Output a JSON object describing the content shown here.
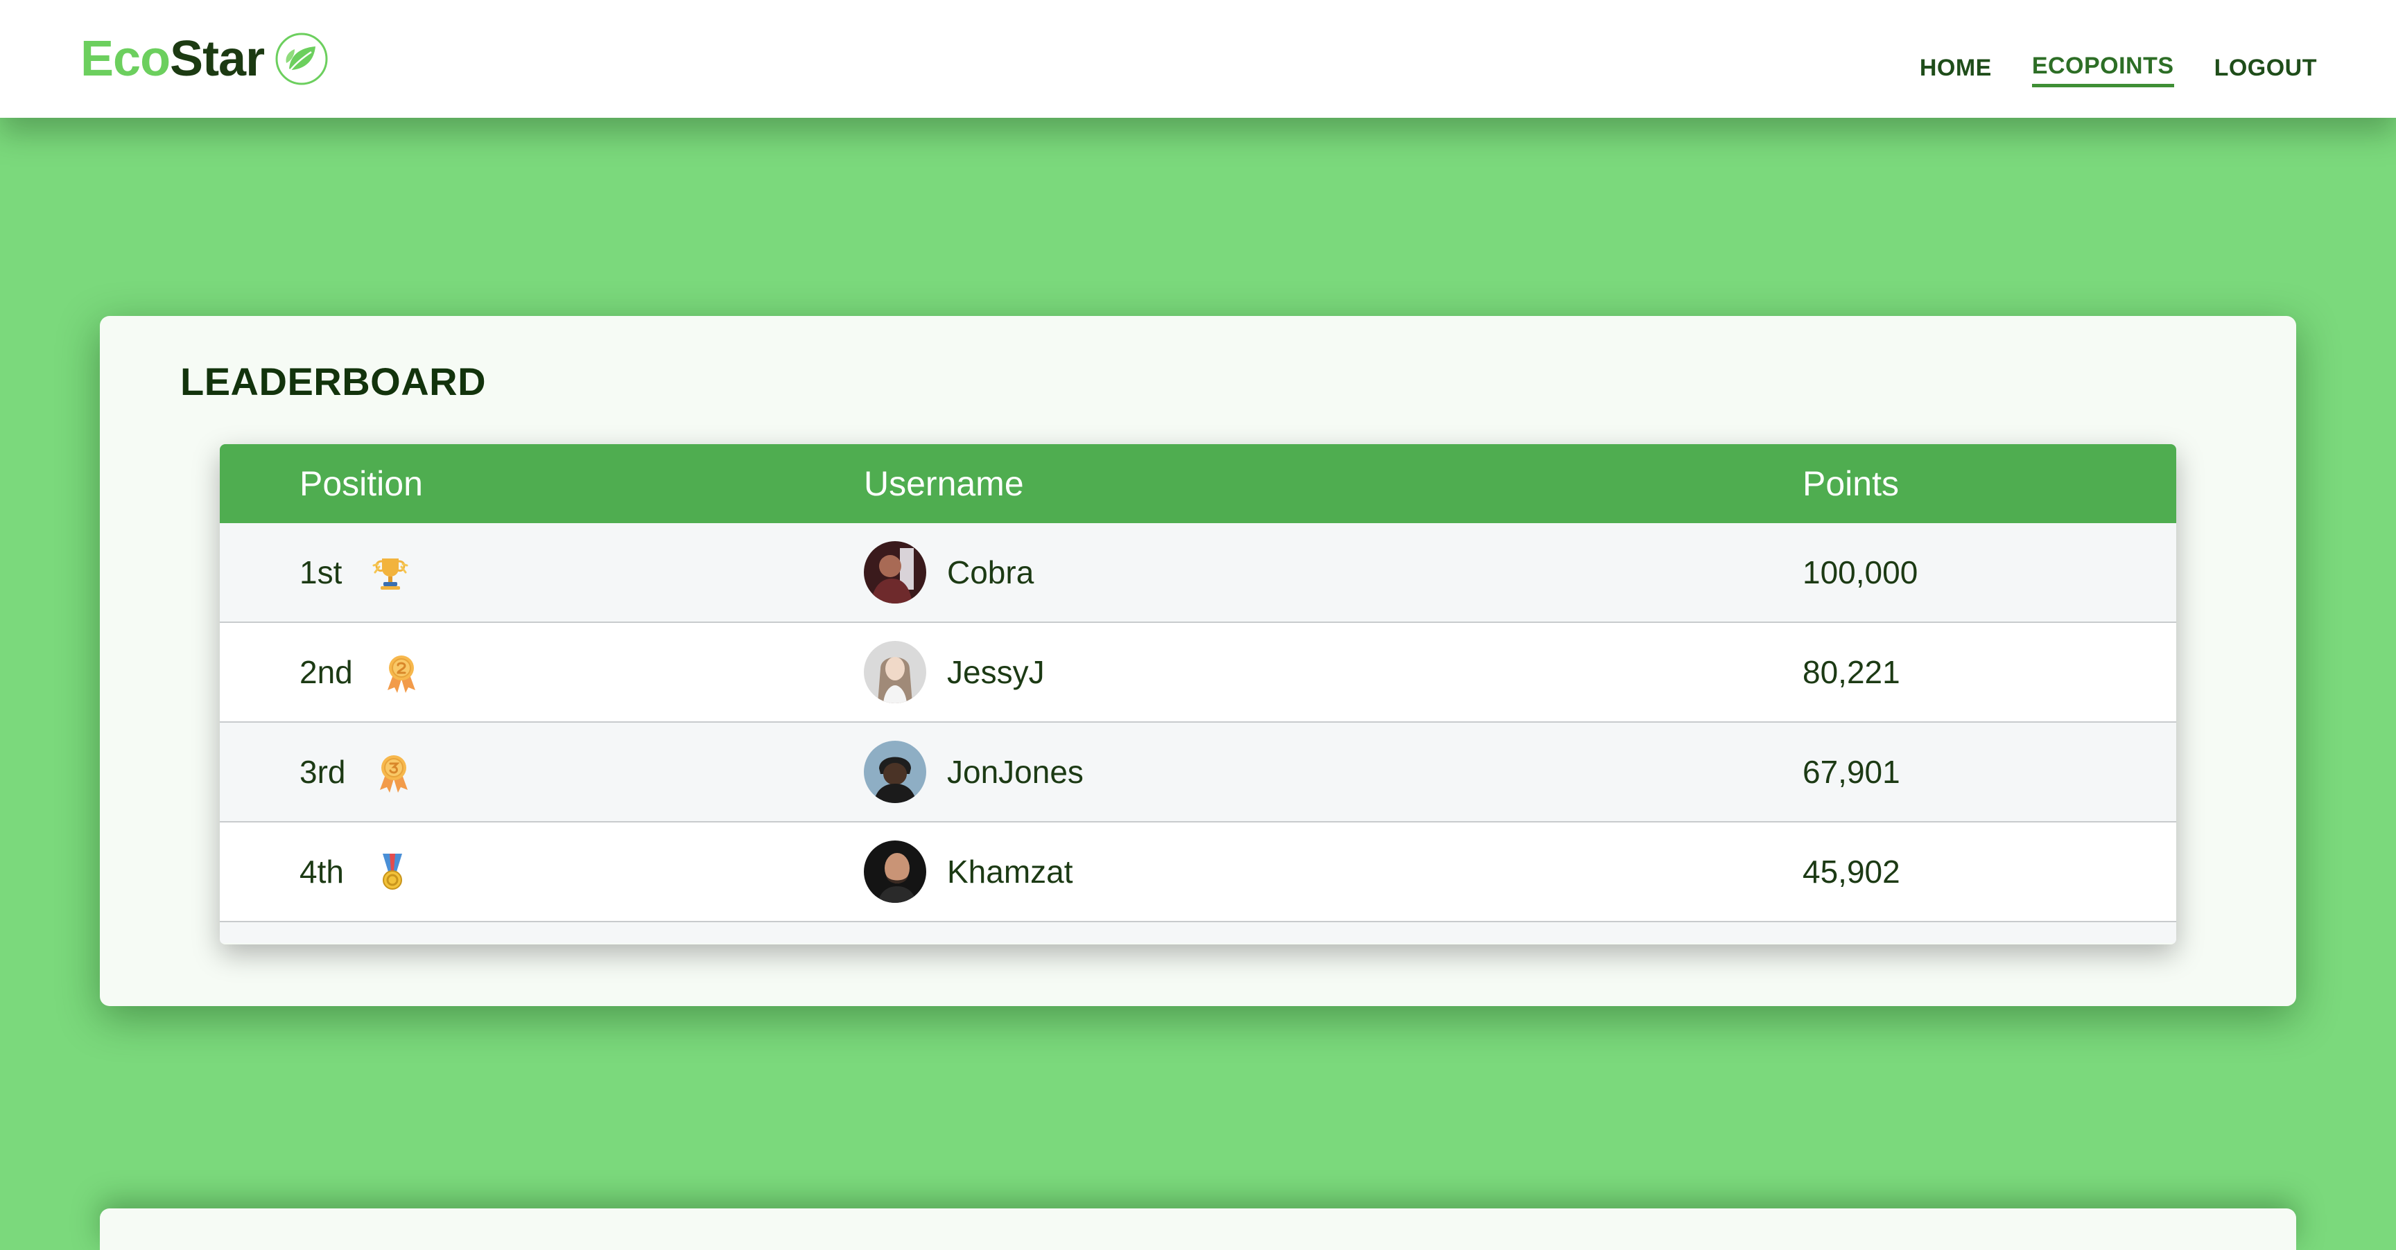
{
  "brand": {
    "name_part1": "Eco",
    "name_part2": "Star",
    "logo_icon": "leaf-globe-icon"
  },
  "nav": {
    "items": [
      {
        "label": "HOME",
        "active": false
      },
      {
        "label": "ECOPOINTS",
        "active": true
      },
      {
        "label": "LOGOUT",
        "active": false
      }
    ]
  },
  "leaderboard": {
    "title": "LEADERBOARD",
    "columns": [
      "Position",
      "Username",
      "Points"
    ],
    "rows": [
      {
        "position": "1st",
        "rank_icon": "trophy-icon",
        "username": "Cobra",
        "points": "100,000"
      },
      {
        "position": "2nd",
        "rank_icon": "medal-2-icon",
        "username": "JessyJ",
        "points": "80,221"
      },
      {
        "position": "3rd",
        "rank_icon": "medal-3-icon",
        "username": "JonJones",
        "points": "67,901"
      },
      {
        "position": "4th",
        "rank_icon": "medal-ribbon-icon",
        "username": "Khamzat",
        "points": "45,902"
      }
    ]
  },
  "colors": {
    "page_background": "#7bd97c",
    "header_green": "#4fad50",
    "brand_light": "#6ccf5e",
    "brand_dark": "#1c3a12",
    "nav_text": "#1f4d1a"
  }
}
